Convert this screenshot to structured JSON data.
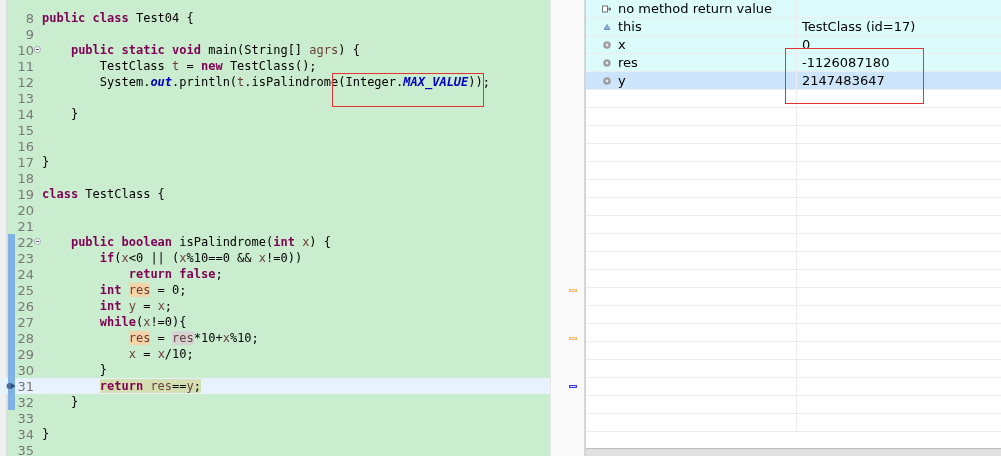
{
  "editor": {
    "annotation_box": true,
    "lines": [
      {
        "number": "8",
        "segments": [
          {
            "text": "public class",
            "kind": "keyword"
          },
          {
            "text": " Test04 {",
            "kind": "plain"
          }
        ]
      },
      {
        "number": "9"
      },
      {
        "number": "10",
        "foldable": true,
        "segments": [
          {
            "text": "    public static void",
            "kind": "keyword"
          },
          {
            "text": " main(String[] ",
            "kind": "plain"
          },
          {
            "text": "agrs",
            "kind": "local"
          },
          {
            "text": ") {",
            "kind": "plain"
          }
        ]
      },
      {
        "number": "11",
        "segments": [
          {
            "text": "        TestClass ",
            "kind": "plain"
          },
          {
            "text": "t",
            "kind": "local"
          },
          {
            "text": " = ",
            "kind": "plain"
          },
          {
            "text": "new",
            "kind": "keyword"
          },
          {
            "text": " TestClass();",
            "kind": "plain"
          }
        ]
      },
      {
        "number": "12",
        "segments": [
          {
            "text": "        System.",
            "kind": "plain"
          },
          {
            "text": "out",
            "kind": "static"
          },
          {
            "text": ".println(",
            "kind": "plain"
          },
          {
            "text": "t",
            "kind": "local"
          },
          {
            "text": ".isPalindrome(Integer.",
            "kind": "plain"
          },
          {
            "text": "MAX_VALUE",
            "kind": "static"
          },
          {
            "text": "));",
            "kind": "plain"
          }
        ]
      },
      {
        "number": "13"
      },
      {
        "number": "14",
        "segments": [
          {
            "text": "    }",
            "kind": "plain"
          }
        ]
      },
      {
        "number": "15"
      },
      {
        "number": "16"
      },
      {
        "number": "17",
        "segments": [
          {
            "text": "}",
            "kind": "plain"
          }
        ]
      },
      {
        "number": "18"
      },
      {
        "number": "19",
        "segments": [
          {
            "text": "class",
            "kind": "keyword"
          },
          {
            "text": " TestClass {",
            "kind": "plain"
          }
        ]
      },
      {
        "number": "20"
      },
      {
        "number": "21"
      },
      {
        "number": "22",
        "foldable": true,
        "in_range": true,
        "segments": [
          {
            "text": "    public boolean",
            "kind": "keyword"
          },
          {
            "text": " isPalindrome(",
            "kind": "plain"
          },
          {
            "text": "int ",
            "kind": "keyword"
          },
          {
            "text": "x",
            "kind": "local"
          },
          {
            "text": ") {",
            "kind": "plain"
          }
        ]
      },
      {
        "number": "23",
        "in_range": true,
        "segments": [
          {
            "text": "        if",
            "kind": "keyword"
          },
          {
            "text": "(",
            "kind": "plain"
          },
          {
            "text": "x",
            "kind": "local"
          },
          {
            "text": "<0 || (",
            "kind": "plain"
          },
          {
            "text": "x",
            "kind": "local"
          },
          {
            "text": "%10==0 && ",
            "kind": "plain"
          },
          {
            "text": "x",
            "kind": "local"
          },
          {
            "text": "!=0))",
            "kind": "plain"
          }
        ]
      },
      {
        "number": "24",
        "in_range": true,
        "segments": [
          {
            "text": "            return false",
            "kind": "keyword"
          },
          {
            "text": ";",
            "kind": "plain"
          }
        ]
      },
      {
        "number": "25",
        "in_range": true,
        "has_occurrence": true,
        "segments": [
          {
            "text": "        int ",
            "kind": "keyword"
          },
          {
            "text": "res",
            "kind": "local",
            "occurrence": true,
            "write_access": true
          },
          {
            "text": " = 0;",
            "kind": "plain"
          }
        ]
      },
      {
        "number": "26",
        "in_range": true,
        "segments": [
          {
            "text": "        int ",
            "kind": "keyword"
          },
          {
            "text": "y",
            "kind": "local"
          },
          {
            "text": " = ",
            "kind": "plain"
          },
          {
            "text": "x",
            "kind": "local"
          },
          {
            "text": ";",
            "kind": "plain"
          }
        ]
      },
      {
        "number": "27",
        "in_range": true,
        "segments": [
          {
            "text": "        while",
            "kind": "keyword"
          },
          {
            "text": "(",
            "kind": "plain"
          },
          {
            "text": "x",
            "kind": "local"
          },
          {
            "text": "!=0){",
            "kind": "plain"
          }
        ]
      },
      {
        "number": "28",
        "in_range": true,
        "has_occurrence": true,
        "segments": [
          {
            "text": "            res",
            "kind": "local",
            "occurrence": true,
            "write_access": true
          },
          {
            "text": " = ",
            "kind": "plain"
          },
          {
            "text": "res",
            "kind": "local",
            "occurrence": true,
            "write_access": false
          },
          {
            "text": "*10+",
            "kind": "plain"
          },
          {
            "text": "x",
            "kind": "local"
          },
          {
            "text": "%10;",
            "kind": "plain"
          }
        ]
      },
      {
        "number": "29",
        "in_range": true,
        "segments": [
          {
            "text": "            x",
            "kind": "local"
          },
          {
            "text": " = ",
            "kind": "plain"
          },
          {
            "text": "x",
            "kind": "local"
          },
          {
            "text": "/10;",
            "kind": "plain"
          }
        ]
      },
      {
        "number": "30",
        "in_range": true,
        "segments": [
          {
            "text": "        }",
            "kind": "plain"
          }
        ]
      },
      {
        "number": "31",
        "in_range": true,
        "current": true,
        "segments": [
          {
            "text": "        return ",
            "kind": "keyword"
          },
          {
            "text": "res",
            "kind": "local"
          },
          {
            "text": "==",
            "kind": "plain"
          },
          {
            "text": "y",
            "kind": "local"
          },
          {
            "text": ";",
            "kind": "plain"
          }
        ]
      },
      {
        "number": "32",
        "in_range": true,
        "segments": [
          {
            "text": "    }",
            "kind": "plain"
          }
        ]
      },
      {
        "number": "33"
      },
      {
        "number": "34",
        "segments": [
          {
            "text": "}",
            "kind": "plain"
          }
        ]
      },
      {
        "number": "35"
      }
    ]
  },
  "variables": {
    "annotation_box": true,
    "rows": [
      {
        "name": "no method return value",
        "kind": "return",
        "selected": false
      },
      {
        "name": "this",
        "value": "TestClass  (id=17)",
        "kind": "this",
        "selected": false
      },
      {
        "name": "x",
        "value": "0",
        "kind": "local",
        "selected": false
      },
      {
        "name": "res",
        "value": "-1126087180",
        "kind": "local",
        "selected": false
      },
      {
        "name": "y",
        "value": "2147483647",
        "kind": "local",
        "selected": true
      }
    ]
  }
}
